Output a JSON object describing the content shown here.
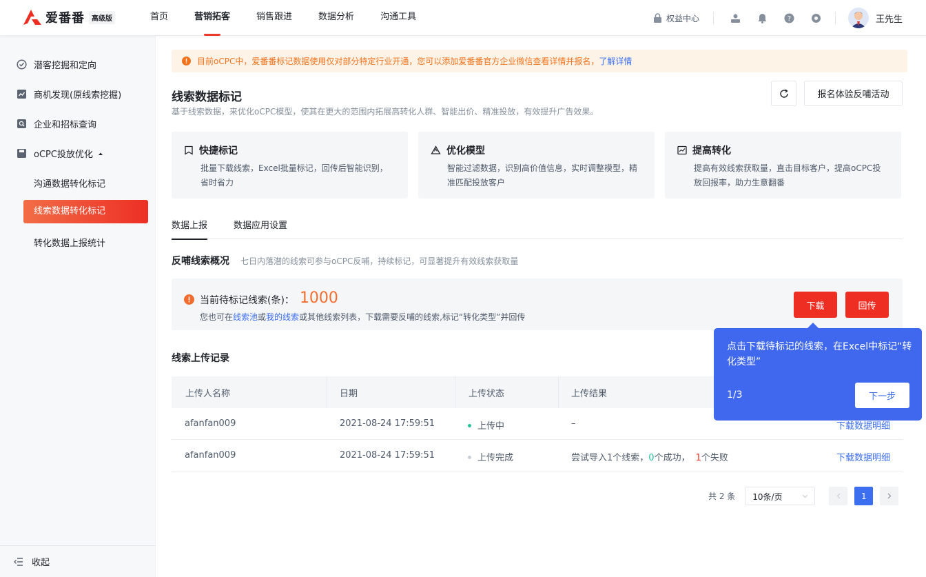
{
  "brand": {
    "name": "爱番番",
    "edition": "高级版"
  },
  "nav": [
    {
      "label": "首页"
    },
    {
      "label": "营销拓客"
    },
    {
      "label": "销售跟进"
    },
    {
      "label": "数据分析"
    },
    {
      "label": "沟通工具"
    }
  ],
  "header": {
    "rights_label": "权益中心",
    "user_name": "王先生",
    "icons": [
      "lock-icon",
      "user-card-icon",
      "bell-icon",
      "help-icon",
      "settings-icon"
    ]
  },
  "sidebar": {
    "items": [
      {
        "label": "潜客挖掘和定向",
        "icon": "target-icon"
      },
      {
        "label": "商机发现(原线索挖掘)",
        "icon": "chart-icon"
      },
      {
        "label": "企业和招标查询",
        "icon": "search-doc-icon"
      },
      {
        "label": "oCPC投放优化",
        "icon": "save-icon"
      }
    ],
    "subitems": [
      {
        "label": "沟通数据转化标记"
      },
      {
        "label": "线索数据转化标记"
      },
      {
        "label": "转化数据上报统计"
      }
    ],
    "collapse_label": "收起"
  },
  "alert": {
    "text": "目前oCPC中，爱番番标记数据使用仅对部分特定行业开通，您可以添加爱番番官方企业微信查看详情并报名，",
    "link": "了解详情"
  },
  "page": {
    "title": "线索数据标记",
    "subtitle": "基于线索数据，来优化oCPC模型，使其在更大的范围内拓展高转化人群、智能出价、精准投放，有效提升广告效果。",
    "signup_button": "报名体验反哺活动"
  },
  "cards": [
    {
      "title": "快捷标记",
      "desc": "批量下载线索，Excel批量标记，回传后智能识别，省时省力"
    },
    {
      "title": "优化模型",
      "desc": "智能过滤数据，识别高价值信息，实时调整模型，精准匹配投放客户"
    },
    {
      "title": "提高转化",
      "desc": "提高有效线索获取量，直击目标客户，提高oCPC投放回报率，助力生意翻番"
    }
  ],
  "tabs": [
    {
      "label": "数据上报"
    },
    {
      "label": "数据应用设置"
    }
  ],
  "overview": {
    "title": "反哺线索概况",
    "desc": "七日内落潜的线索可参与oCPC反哺，持续标记，可显著提升有效线索获取量"
  },
  "pending": {
    "label": "当前待标记线索(条)：",
    "count": "1000",
    "desc_pre": "您也可在",
    "link1": "线索池",
    "desc_mid": "或",
    "link2": "我的线索",
    "desc_post": "或其他线索列表，下载需要反哺的线索,标记“转化类型”并回传",
    "download": "下载",
    "upload": "回传"
  },
  "records": {
    "title": "线索上传记录",
    "columns": [
      "上传人名称",
      "日期",
      "上传状态",
      "上传结果"
    ],
    "rows": [
      {
        "name": "afanfan009",
        "date": "2021-08-24 17:59:51",
        "status": "上传中",
        "status_color": "#26c29a",
        "result": "–",
        "action": "下载数据明细"
      },
      {
        "name": "afanfan009",
        "date": "2021-08-24 17:59:51",
        "status": "上传完成",
        "status_color": "#c9cdd4",
        "result_pre": "尝试导入1个线索，",
        "success": "0",
        "result_mid": "个成功，",
        "fail": "1",
        "result_post": "个失败",
        "action": "下载数据明细"
      }
    ]
  },
  "pagination": {
    "total": "共 2 条",
    "page_size": "10条/页",
    "current": "1"
  },
  "tour": {
    "text": "点击下载待标记的线索，在Excel中标记“转化类型”",
    "counter": "1/3",
    "next": "下一步"
  }
}
